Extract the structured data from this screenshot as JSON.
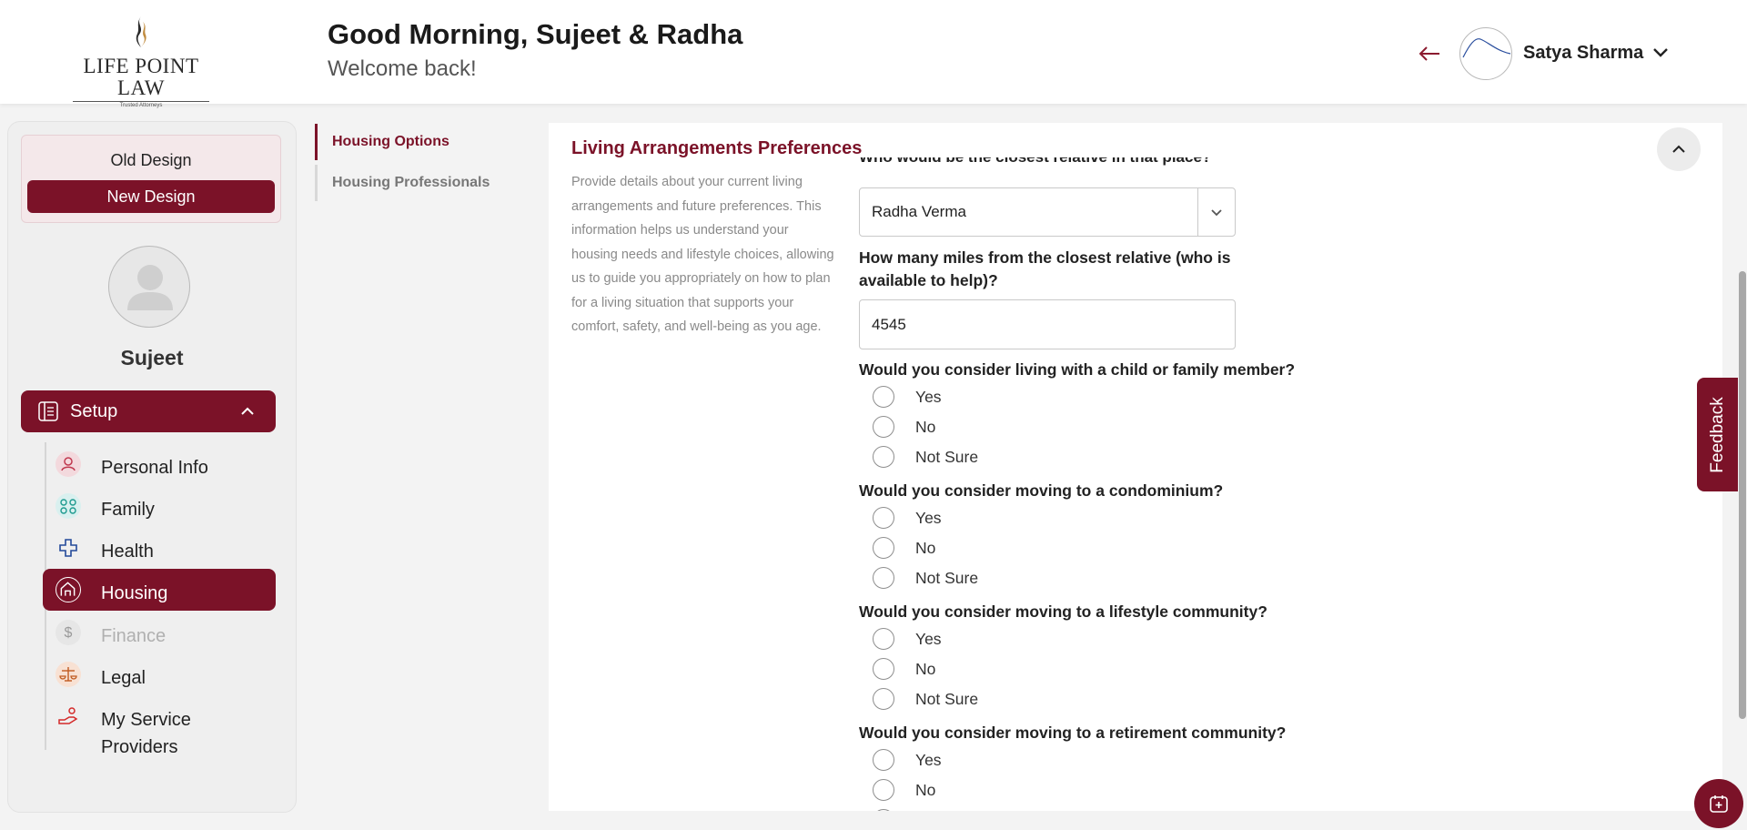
{
  "header": {
    "logo_text": "LIFE POINT LAW",
    "logo_sub": "Trusted Attorneys",
    "greeting": "Good Morning, Sujeet & Radha",
    "welcome": "Welcome back!",
    "user_name": "Satya Sharma"
  },
  "sidebar": {
    "old_design": "Old Design",
    "new_design": "New Design",
    "profile_name": "Sujeet",
    "setup_label": "Setup",
    "items": [
      {
        "label": "Personal Info",
        "icon": "person-icon"
      },
      {
        "label": "Family",
        "icon": "family-icon"
      },
      {
        "label": "Health",
        "icon": "health-cross-icon"
      },
      {
        "label": "Housing",
        "icon": "home-icon"
      },
      {
        "label": "Finance",
        "icon": "dollar-icon"
      },
      {
        "label": "Legal",
        "icon": "scales-icon"
      },
      {
        "label": "My Service Providers",
        "icon": "service-hand-icon"
      }
    ]
  },
  "subnav": {
    "items": [
      {
        "label": "Housing Options"
      },
      {
        "label": "Housing Professionals"
      }
    ]
  },
  "section": {
    "title": "Living Arrangements Preferences",
    "description": "Provide details about your current living arrangements and future preferences. This information helps us understand your housing needs and lifestyle choices, allowing us to guide you appropriately on how to plan for a living situation that supports your comfort, safety, and well-being as you age."
  },
  "form": {
    "q_closest_relative": "Who would be the closest relative in that place?",
    "closest_relative_value": "Radha Verma",
    "q_miles": "How many miles from the closest relative (who is available to help)?",
    "miles_value": "4545",
    "q_child": "Would you consider living with a child or family member?",
    "q_condo": "Would you consider moving to a condominium?",
    "q_lifestyle": "Would you consider moving to a lifestyle community?",
    "q_retirement": "Would you consider moving to a retirement community?",
    "opt_yes": "Yes",
    "opt_no": "No",
    "opt_not_sure": "Not Sure"
  },
  "feedback_label": "Feedback",
  "colors": {
    "brand": "#7b1228",
    "text": "#1c1c1c",
    "muted": "#8a8a8a"
  }
}
